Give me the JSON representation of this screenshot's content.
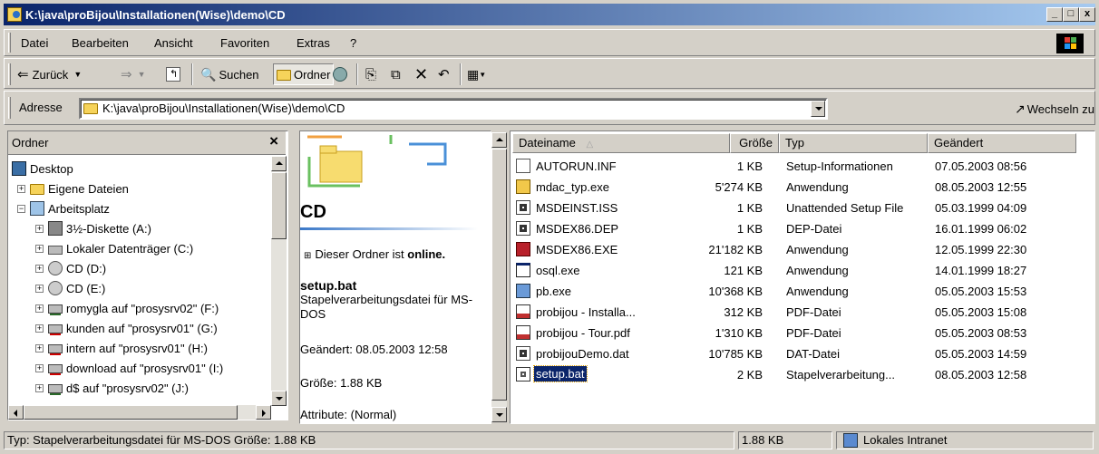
{
  "window": {
    "title": "K:\\java\\proBijou\\Installationen(Wise)\\demo\\CD",
    "min_label": "_",
    "max_label": "□",
    "close_label": "x"
  },
  "menu": {
    "items": [
      "Datei",
      "Bearbeiten",
      "Ansicht",
      "Favoriten",
      "Extras",
      "?"
    ]
  },
  "toolbar": {
    "back_label": "Zurück",
    "search_label": "Suchen",
    "folders_label": "Ordner"
  },
  "address": {
    "label": "Adresse",
    "value": "K:\\java\\proBijou\\Installationen(Wise)\\demo\\CD",
    "go_label": "Wechseln zu"
  },
  "tree": {
    "header": "Ordner",
    "close_label": "×",
    "items": [
      {
        "label": "Desktop",
        "icon": "desktop-icon"
      },
      {
        "label": "Eigene Dateien",
        "icon": "my-documents-icon"
      },
      {
        "label": "Arbeitsplatz",
        "icon": "my-computer-icon"
      },
      {
        "label": "3½-Diskette (A:)",
        "icon": "floppy-icon"
      },
      {
        "label": "Lokaler Datenträger (C:)",
        "icon": "hard-drive-icon"
      },
      {
        "label": "CD (D:)",
        "icon": "cd-drive-icon"
      },
      {
        "label": "CD (E:)",
        "icon": "cd-drive-icon"
      },
      {
        "label": "romygla auf \"prosysrv02\" (F:)",
        "icon": "network-drive-icon"
      },
      {
        "label": "kunden auf \"prosysrv01\" (G:)",
        "icon": "disconnected-network-drive-icon"
      },
      {
        "label": "intern auf \"prosysrv01\" (H:)",
        "icon": "disconnected-network-drive-icon"
      },
      {
        "label": "download auf \"prosysrv01\" (I:)",
        "icon": "disconnected-network-drive-icon"
      },
      {
        "label": "d$ auf \"prosysrv02\" (J:)",
        "icon": "network-drive-icon"
      }
    ]
  },
  "webview": {
    "folder_name": "CD",
    "online_prefix": "Dieser Ordner ist ",
    "online_word": "online.",
    "selected_name": "setup.bat",
    "selected_type": "Stapelverarbeitungsdatei für MS-DOS",
    "modified": "Geändert: 08.05.2003 12:58",
    "size": "Größe: 1.88 KB",
    "attributes": "Attribute: (Normal)"
  },
  "list": {
    "columns": [
      "Dateiname",
      "Größe",
      "Typ",
      "Geändert"
    ],
    "rows": [
      {
        "name": "AUTORUN.INF",
        "size": "1 KB",
        "type": "Setup-Informationen",
        "modified": "07.05.2003 08:56",
        "icon": "setup-info-icon"
      },
      {
        "name": "mdac_typ.exe",
        "size": "5'274 KB",
        "type": "Anwendung",
        "modified": "08.05.2003 12:55",
        "icon": "installer-icon"
      },
      {
        "name": "MSDEINST.ISS",
        "size": "1 KB",
        "type": "Unattended Setup File",
        "modified": "05.03.1999 04:09",
        "icon": "generic-file-icon"
      },
      {
        "name": "MSDEX86.DEP",
        "size": "1 KB",
        "type": "DEP-Datei",
        "modified": "16.01.1999 06:02",
        "icon": "generic-file-icon"
      },
      {
        "name": "MSDEX86.EXE",
        "size": "21'182 KB",
        "type": "Anwendung",
        "modified": "12.05.1999 22:30",
        "icon": "package-icon"
      },
      {
        "name": "osql.exe",
        "size": "121 KB",
        "type": "Anwendung",
        "modified": "14.01.1999 18:27",
        "icon": "console-app-icon"
      },
      {
        "name": "pb.exe",
        "size": "10'368 KB",
        "type": "Anwendung",
        "modified": "05.05.2003 15:53",
        "icon": "installer-icon"
      },
      {
        "name": "probijou - Installa...",
        "size": "312 KB",
        "type": "PDF-Datei",
        "modified": "05.05.2003 15:08",
        "icon": "pdf-icon"
      },
      {
        "name": "probijou - Tour.pdf",
        "size": "1'310 KB",
        "type": "PDF-Datei",
        "modified": "05.05.2003 08:53",
        "icon": "pdf-icon"
      },
      {
        "name": "probijouDemo.dat",
        "size": "10'785 KB",
        "type": "DAT-Datei",
        "modified": "05.05.2003 14:59",
        "icon": "generic-file-icon"
      },
      {
        "name": "setup.bat",
        "size": "2 KB",
        "type": "Stapelverarbeitung...",
        "modified": "08.05.2003 12:58",
        "icon": "batch-file-icon",
        "selected": true
      }
    ]
  },
  "status": {
    "info": "Typ: Stapelverarbeitungsdatei für MS-DOS Größe: 1.88 KB",
    "size": "1.88 KB",
    "zone": "Lokales Intranet"
  },
  "colors": {
    "title_start": "#0a246a",
    "title_end": "#a6caf0",
    "selection": "#0a246a"
  }
}
